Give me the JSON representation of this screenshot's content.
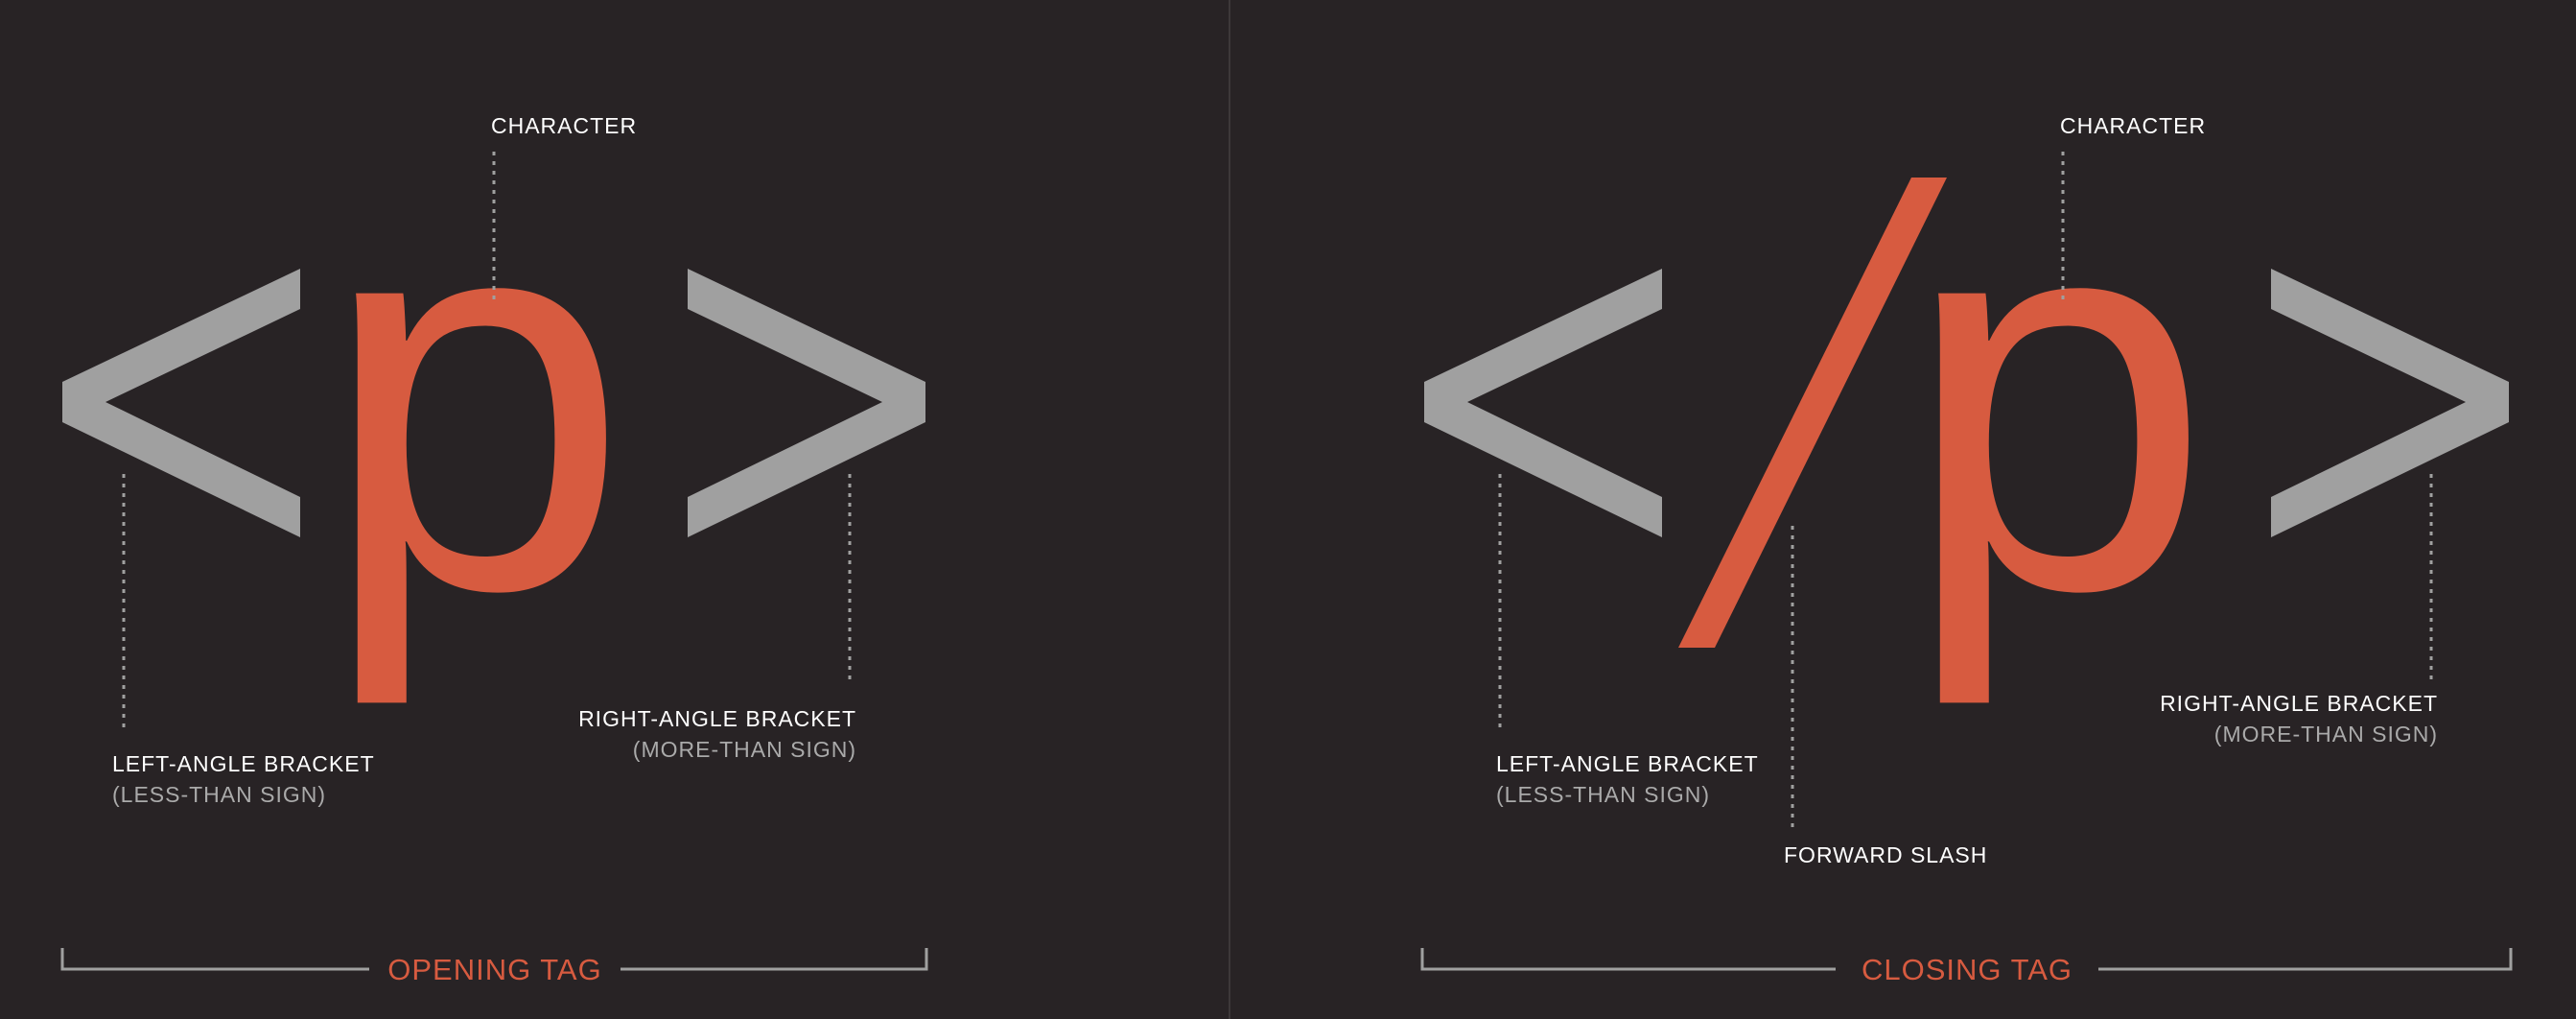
{
  "colors": {
    "background": "#282325",
    "accent": "#d75b40",
    "bracket": "#a0a0a0",
    "label": "#ffffff",
    "sublabel": "#aaaaaa",
    "divider": "#3d3839"
  },
  "opening": {
    "glyph": "p",
    "character_label": "CHARACTER",
    "left_label": "LEFT-ANGLE BRACKET",
    "left_sublabel": "(LESS-THAN SIGN)",
    "right_label": "RIGHT-ANGLE BRACKET",
    "right_sublabel": "(MORE-THAN SIGN)",
    "tag_label": "OPENING TAG"
  },
  "closing": {
    "glyph": "p",
    "character_label": "CHARACTER",
    "left_label": "LEFT-ANGLE BRACKET",
    "left_sublabel": "(LESS-THAN SIGN)",
    "slash_label": "FORWARD SLASH",
    "right_label": "RIGHT-ANGLE BRACKET",
    "right_sublabel": "(MORE-THAN SIGN)",
    "tag_label": "CLOSING TAG"
  }
}
